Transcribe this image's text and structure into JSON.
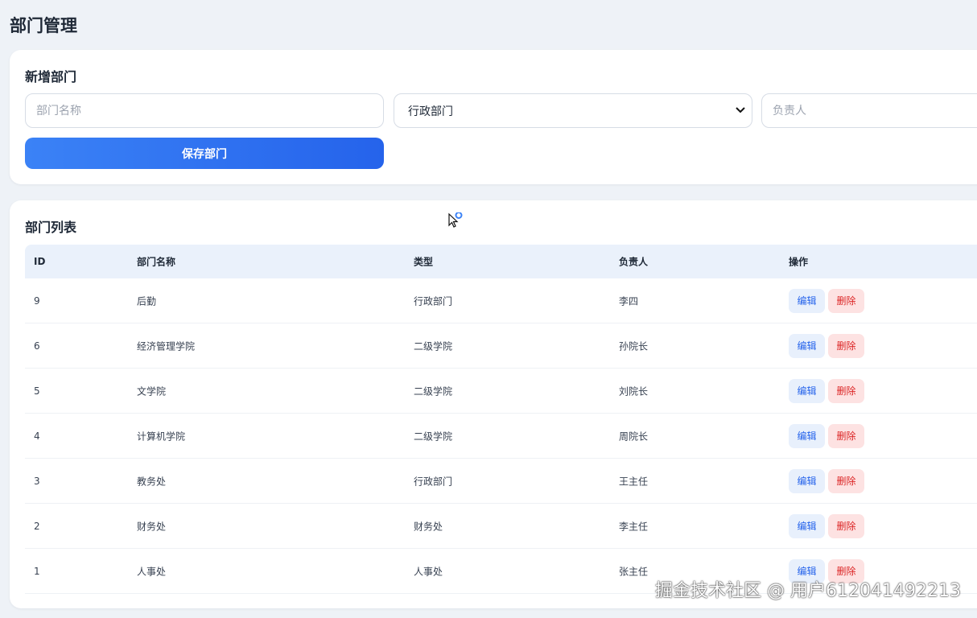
{
  "page": {
    "title": "部门管理"
  },
  "add_form": {
    "title": "新增部门",
    "name_placeholder": "部门名称",
    "type_selected": "行政部门",
    "owner_placeholder": "负责人",
    "save_label": "保存部门"
  },
  "list": {
    "title": "部门列表",
    "columns": [
      "ID",
      "部门名称",
      "类型",
      "负责人",
      "操作"
    ],
    "rows": [
      {
        "id": "9",
        "name": "后勤",
        "type": "行政部门",
        "owner": "李四"
      },
      {
        "id": "6",
        "name": "经济管理学院",
        "type": "二级学院",
        "owner": "孙院长"
      },
      {
        "id": "5",
        "name": "文学院",
        "type": "二级学院",
        "owner": "刘院长"
      },
      {
        "id": "4",
        "name": "计算机学院",
        "type": "二级学院",
        "owner": "周院长"
      },
      {
        "id": "3",
        "name": "教务处",
        "type": "行政部门",
        "owner": "王主任"
      },
      {
        "id": "2",
        "name": "财务处",
        "type": "财务处",
        "owner": "李主任"
      },
      {
        "id": "1",
        "name": "人事处",
        "type": "人事处",
        "owner": "张主任"
      }
    ],
    "edit_label": "编辑",
    "delete_label": "删除"
  },
  "watermark": "掘金技术社区 @ 用户612041492213",
  "colors": {
    "accent": "#2563eb",
    "danger": "#dc2626",
    "header_bg": "#eaf1fb",
    "page_bg": "#eef2f7"
  }
}
